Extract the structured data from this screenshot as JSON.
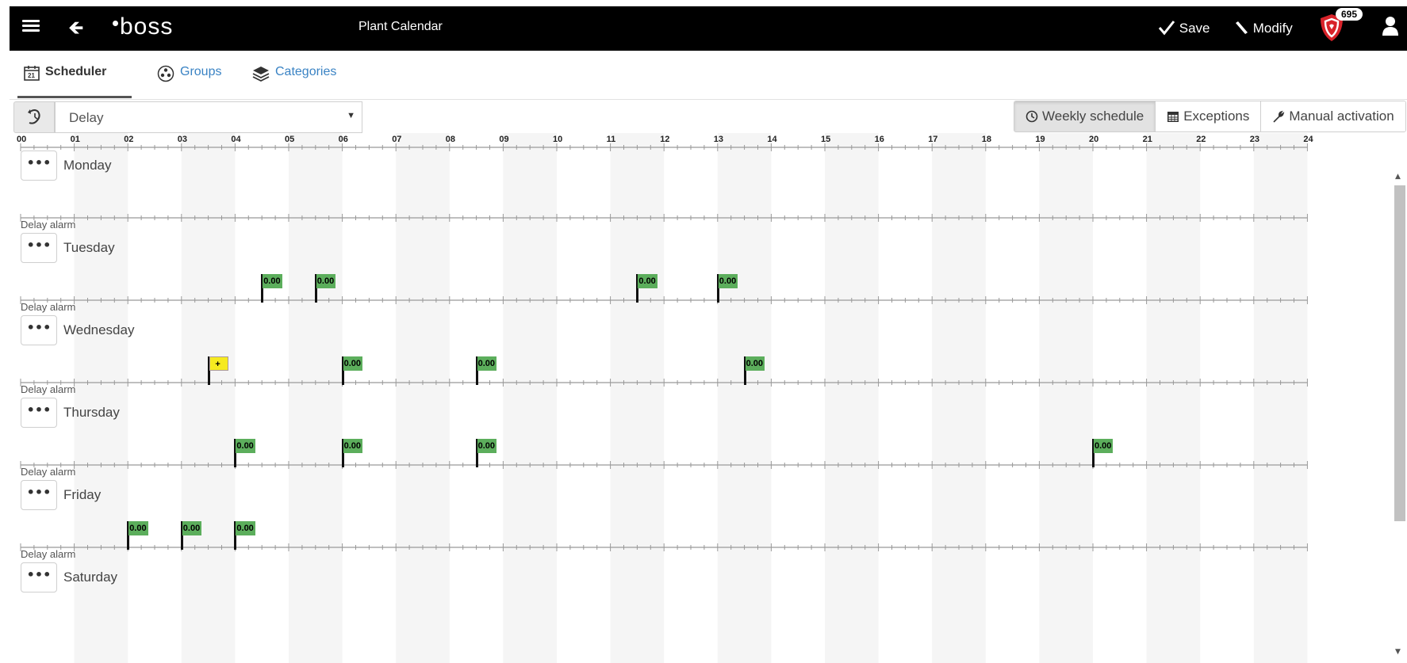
{
  "topbar": {
    "logo_text": "boss",
    "title": "Plant Calendar",
    "save_label": "Save",
    "modify_label": "Modify",
    "alarm_count": "695",
    "icons": {
      "menu": "hamburger-icon",
      "back": "arrow-left-icon",
      "save": "check-icon",
      "modify": "pencil-icon",
      "alarm": "shield-alarm-icon",
      "user": "user-icon"
    }
  },
  "tabs": [
    {
      "label": "Scheduler",
      "icon": "calendar-icon",
      "active": true
    },
    {
      "label": "Groups",
      "icon": "groups-icon",
      "active": false
    },
    {
      "label": "Categories",
      "icon": "layers-icon",
      "active": false
    }
  ],
  "toolbar": {
    "selected_category": "Delay",
    "views": [
      {
        "label": "Weekly schedule",
        "icon": "clock-icon",
        "active": true
      },
      {
        "label": "Exceptions",
        "icon": "calendar-icon",
        "active": false
      },
      {
        "label": "Manual activation",
        "icon": "wrench-icon",
        "active": false
      }
    ]
  },
  "timeline": {
    "hours": [
      "00",
      "01",
      "02",
      "03",
      "04",
      "05",
      "06",
      "07",
      "08",
      "09",
      "10",
      "11",
      "12",
      "13",
      "14",
      "15",
      "16",
      "17",
      "18",
      "19",
      "20",
      "21",
      "22",
      "23",
      "24"
    ],
    "alarm_label": "Delay alarm",
    "colors": {
      "event": "#5cae5c",
      "selected_event": "#f6ea1f",
      "stripe": "#f5f5f5"
    },
    "days": [
      {
        "name": "Monday",
        "events": []
      },
      {
        "name": "Tuesday",
        "events": [
          {
            "hour": 4.5,
            "label": "0.00"
          },
          {
            "hour": 5.5,
            "label": "0.00"
          },
          {
            "hour": 11.5,
            "label": "0.00"
          },
          {
            "hour": 13.0,
            "label": "0.00"
          }
        ]
      },
      {
        "name": "Wednesday",
        "events": [
          {
            "hour": 3.5,
            "label": "+",
            "selected": true
          },
          {
            "hour": 6.0,
            "label": "0.00"
          },
          {
            "hour": 8.5,
            "label": "0.00"
          },
          {
            "hour": 13.5,
            "label": "0.00"
          }
        ]
      },
      {
        "name": "Thursday",
        "events": [
          {
            "hour": 4.0,
            "label": "0.00"
          },
          {
            "hour": 6.0,
            "label": "0.00"
          },
          {
            "hour": 8.5,
            "label": "0.00"
          },
          {
            "hour": 20.0,
            "label": "0.00"
          }
        ]
      },
      {
        "name": "Friday",
        "events": [
          {
            "hour": 2.0,
            "label": "0.00"
          },
          {
            "hour": 3.0,
            "label": "0.00"
          },
          {
            "hour": 4.0,
            "label": "0.00"
          }
        ]
      },
      {
        "name": "Saturday",
        "events": []
      }
    ]
  }
}
